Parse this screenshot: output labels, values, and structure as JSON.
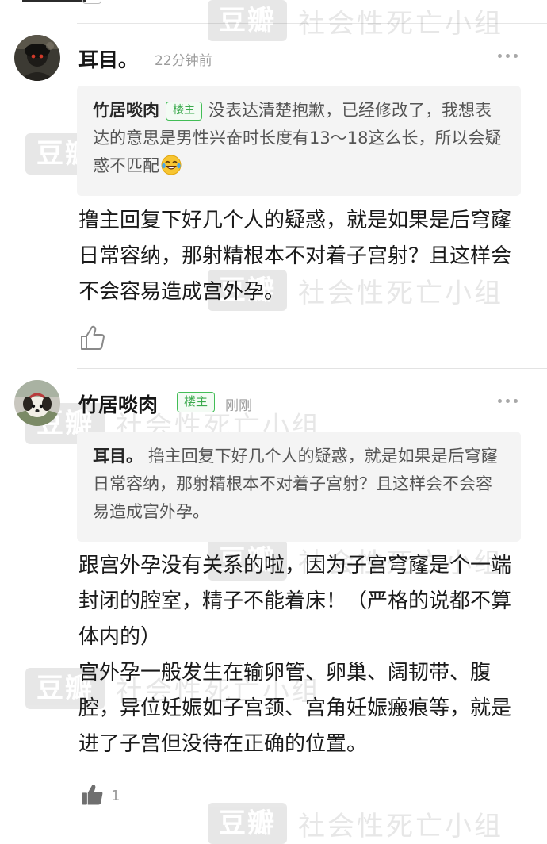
{
  "watermark": {
    "logo": "豆瓣",
    "group": "社会性死亡小组"
  },
  "comments": [
    {
      "author": "耳目。",
      "time": "22分钟前",
      "avatar_icon": "dark-portrait-avatar",
      "quote": {
        "author": "竹居啖肉",
        "badge": "楼主",
        "text": "没表达清楚抱歉，已经修改了，我想表达的意思是男性兴奋时长度有13～18这么长，所以会疑惑不匹配",
        "emoji": "laughing-tears-emoji"
      },
      "paragraphs": [
        "撸主回复下好几个人的疑惑，就是如果是后穹窿日常容纳，那射精根本不对着子宫射？且这样会不会容易造成宫外孕。"
      ],
      "like_icon": "thumbs-up-outline-icon",
      "more_icon": "more-dots-icon"
    },
    {
      "author": "竹居啖肉",
      "badge": "楼主",
      "time": "刚刚",
      "avatar_icon": "puppy-photo-avatar",
      "quote": {
        "author": "耳目。",
        "text": "撸主回复下好几个人的疑惑，就是如果是后穹窿日常容纳，那射精根本不对着子宫射？且这样会不会容易造成宫外孕。"
      },
      "paragraphs": [
        "跟宫外孕没有关系的啦，因为子宫穹窿是个一端封闭的腔室，精子不能着床！（严格的说都不算体内的）",
        "宫外孕一般发生在输卵管、卵巢、阔韧带、腹腔，异位妊娠如子宫颈、宫角妊娠瘢痕等，就是进了子宫但没待在正确的位置。"
      ],
      "like_count": "1",
      "like_icon": "thumbs-up-filled-icon",
      "more_icon": "more-dots-icon"
    }
  ],
  "colors": {
    "badge_green": "#42bd56",
    "quote_bg": "#f4f4f4",
    "meta_gray": "#9c9c9c"
  }
}
